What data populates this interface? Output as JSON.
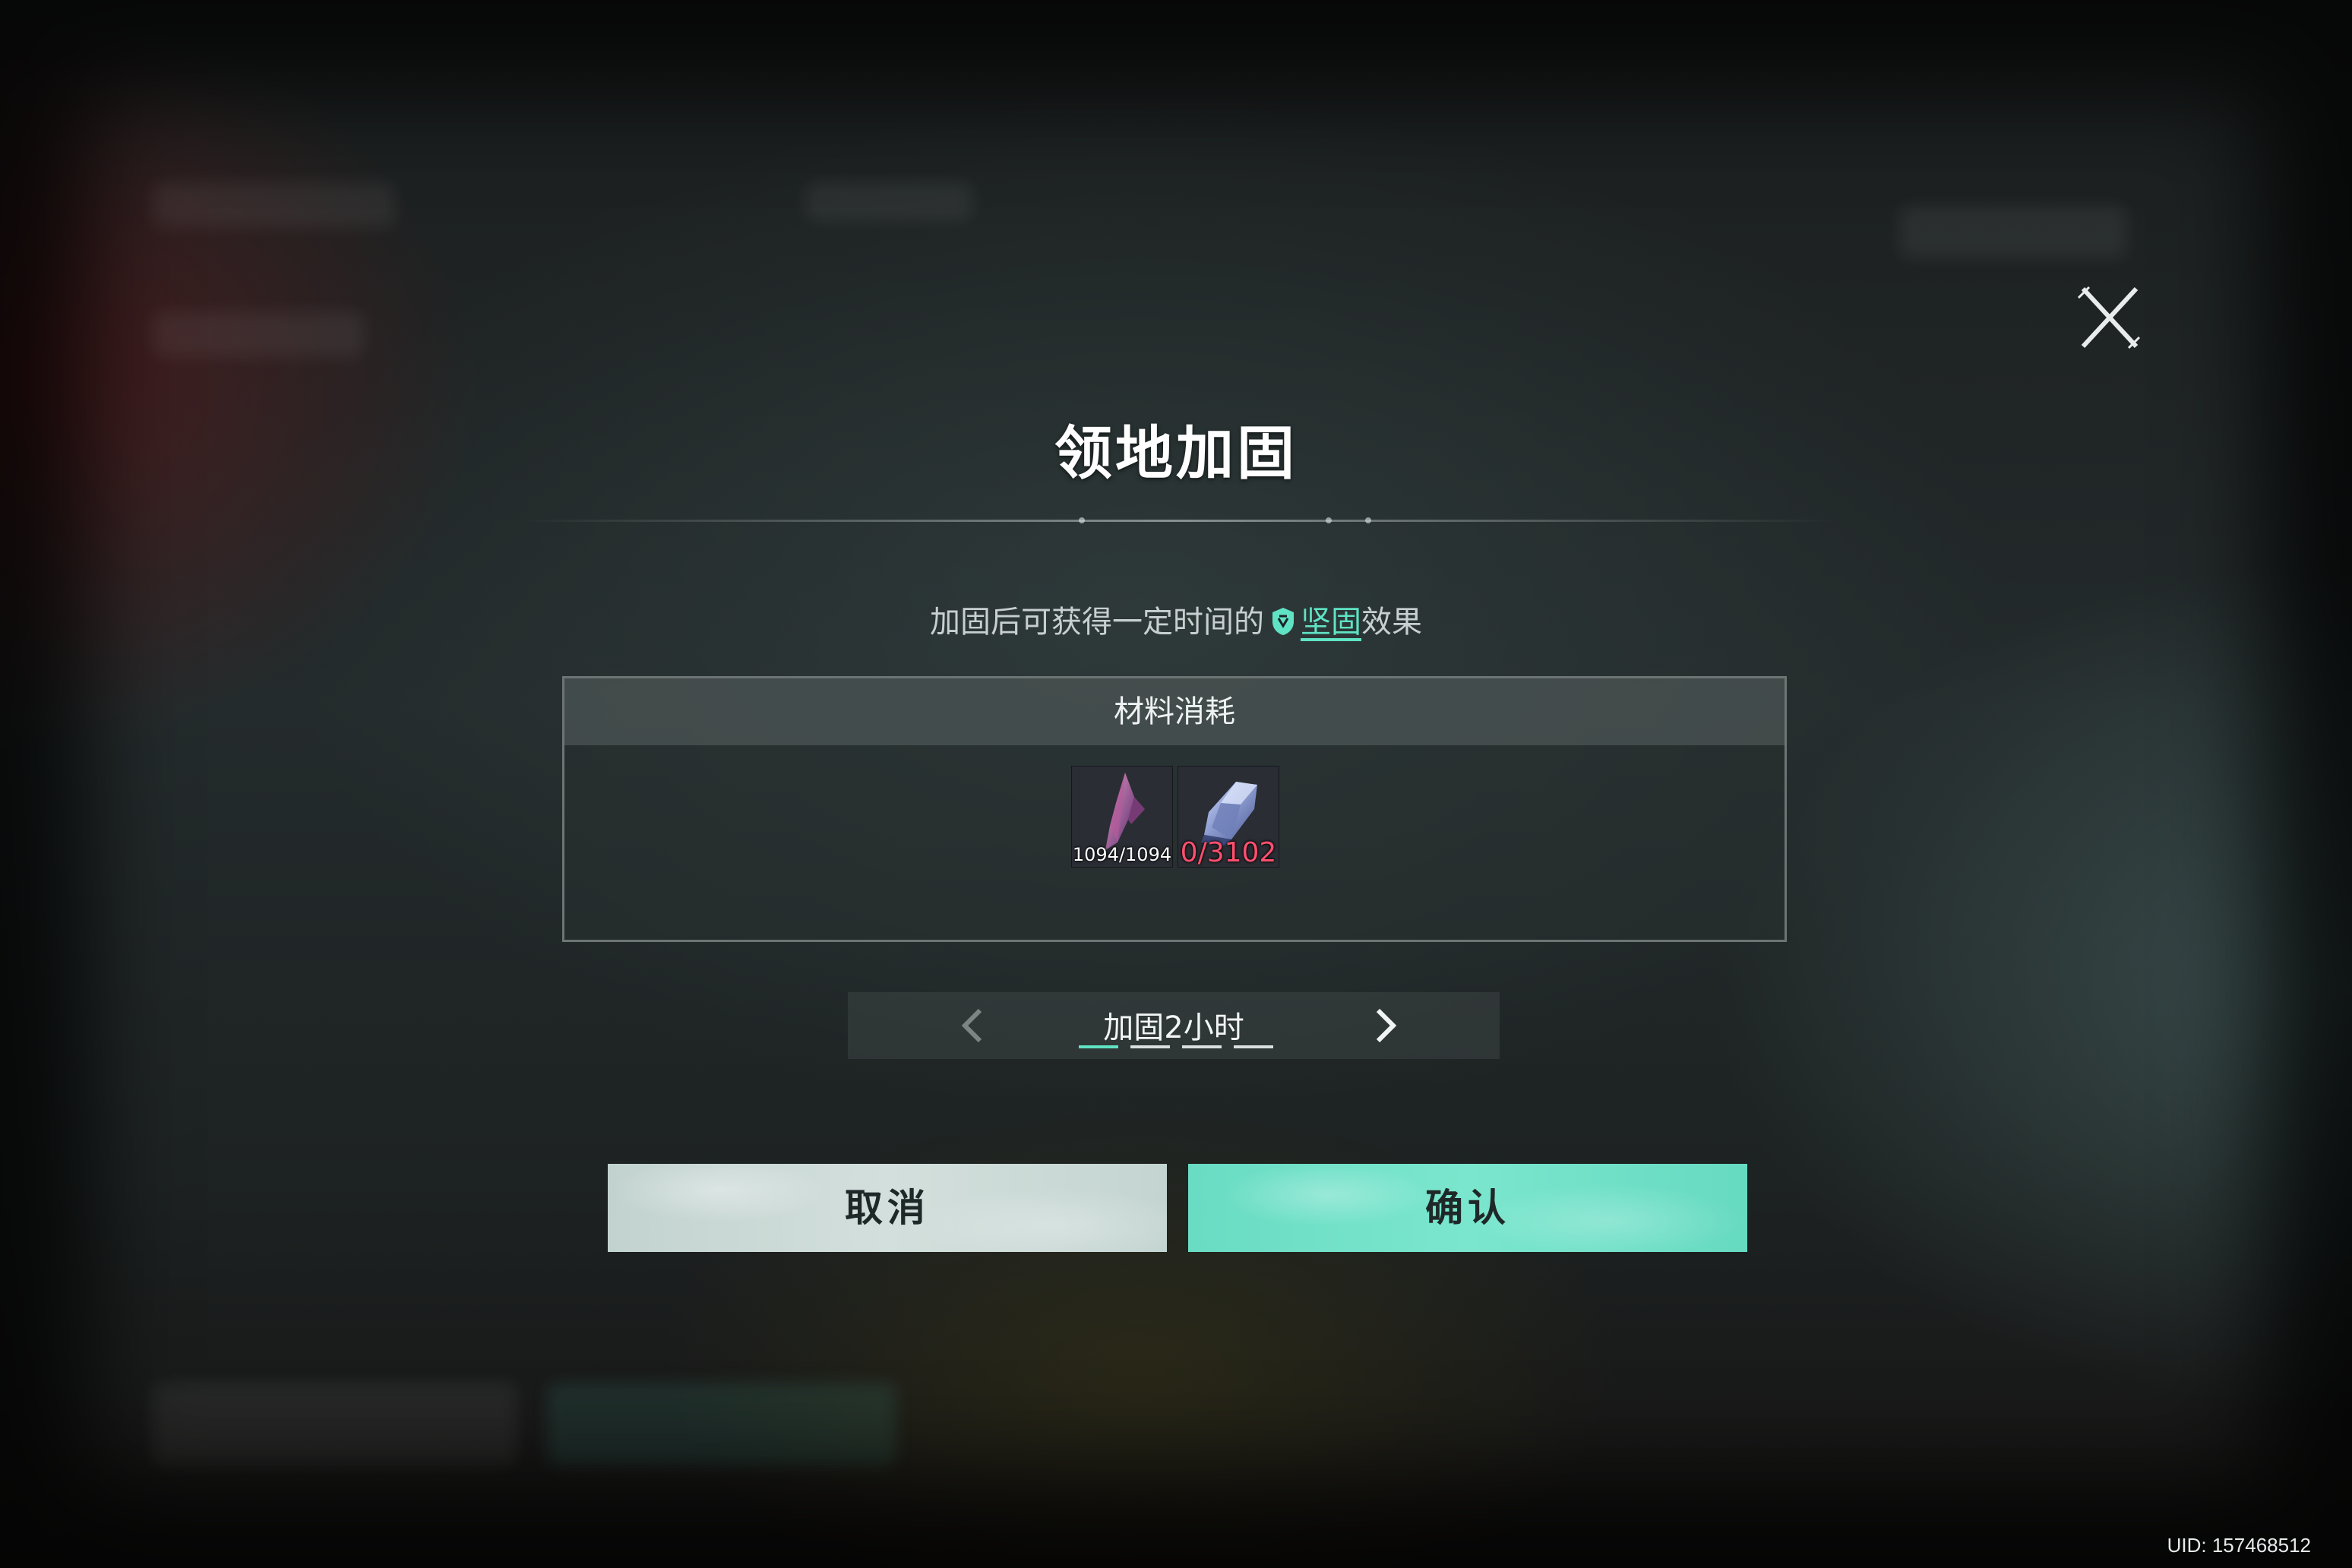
{
  "dialog": {
    "title": "领地加固",
    "description_prefix": "加固后可获得一定时间的",
    "description_link": "坚固",
    "description_suffix": "效果",
    "close_icon": "close-x-icon",
    "shield_icon": "shield-icon"
  },
  "materials": {
    "header": "材料消耗",
    "items": [
      {
        "icon": "purple-crystal-icon",
        "count": "1094/1094",
        "sufficient": true
      },
      {
        "icon": "blue-ore-icon",
        "count": "0/3102",
        "sufficient": false
      }
    ]
  },
  "duration": {
    "label": "加固2小时",
    "options_count": 4,
    "selected_index": 0,
    "prev_icon": "chevron-left-icon",
    "next_icon": "chevron-right-icon"
  },
  "buttons": {
    "cancel": "取消",
    "confirm": "确认"
  },
  "footer": {
    "uid": "UID: 157468512"
  },
  "colors": {
    "accent": "#5fe3c4",
    "insufficient": "#ff4f6e",
    "confirm_button": "#72e2c9",
    "cancel_button": "#cddad7"
  }
}
